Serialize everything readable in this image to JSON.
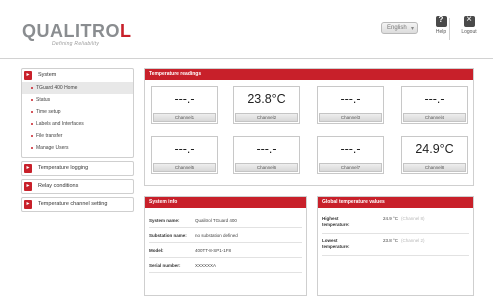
{
  "header": {
    "brand": "QUALITROL",
    "brand_red": "L",
    "brand_prefix": "QUALITRO",
    "tagline": "Defining Reliability",
    "language": "English",
    "help_label": "Help",
    "logout_label": "Logout",
    "icons": {
      "help": "help-icon",
      "logout": "logout-icon",
      "dropdown": "chevron-down-icon"
    }
  },
  "colors": {
    "accent": "#c8202a",
    "text": "#333333"
  },
  "sidebar": {
    "groups": [
      {
        "label": "System",
        "items": [
          {
            "label": "TGuard 400 Home",
            "active": true
          },
          {
            "label": "Status"
          },
          {
            "label": "Time setup"
          },
          {
            "label": "Labels and Interfaces"
          },
          {
            "label": "File transfer"
          },
          {
            "label": "Manage Users"
          }
        ]
      },
      {
        "label": "Temperature logging",
        "items": []
      },
      {
        "label": "Relay conditions",
        "items": []
      },
      {
        "label": "Temperature channel setting",
        "items": []
      }
    ]
  },
  "readings": {
    "title": "Temperature readings",
    "channels": [
      {
        "name": "Channel1",
        "value": "---.-"
      },
      {
        "name": "Channel2",
        "value": "23.8°C"
      },
      {
        "name": "Channel3",
        "value": "---.-"
      },
      {
        "name": "Channel4",
        "value": "---.-"
      },
      {
        "name": "Channel5",
        "value": "---.-"
      },
      {
        "name": "Channel6",
        "value": "---.-"
      },
      {
        "name": "Channel7",
        "value": "---.-"
      },
      {
        "name": "Channel8",
        "value": "24.9°C"
      }
    ]
  },
  "system_info": {
    "title": "System info",
    "rows": [
      {
        "label": "System name:",
        "value": "Qualitrol TGuard 400"
      },
      {
        "label": "Substation name:",
        "value": "no substation defined"
      },
      {
        "label": "Model:",
        "value": "400TT-8-SP1-1F8"
      },
      {
        "label": "Serial number:",
        "value": "XXXXXXA"
      }
    ]
  },
  "global_temps": {
    "title": "Global temperature values",
    "rows": [
      {
        "label": "Highest temperature:",
        "value": "24.9 °C",
        "channel": "(Channel 8)"
      },
      {
        "label": "Lowest temperature:",
        "value": "23.8 °C",
        "channel": "(Channel 2)"
      }
    ]
  }
}
